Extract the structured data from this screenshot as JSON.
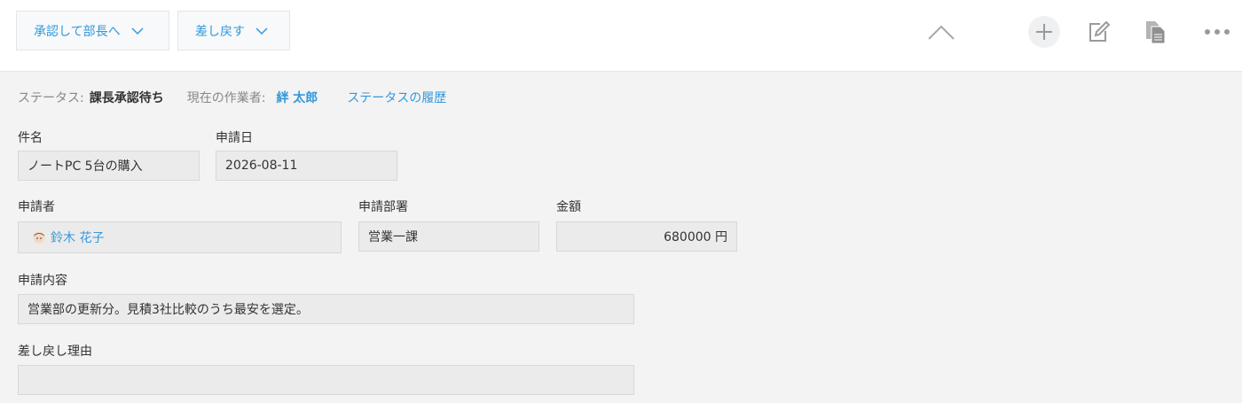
{
  "toolbar": {
    "approve_label": "承認して部長へ",
    "return_label": "差し戻す"
  },
  "icons": {
    "collapse": "chevron-up-icon",
    "add": "plus-icon",
    "edit": "edit-icon",
    "copy": "copy-icon",
    "more": "more-icon"
  },
  "status": {
    "label": "ステータス:",
    "value": "課長承認待ち",
    "assignee_label": "現在の作業者:",
    "assignee": "絆 太郎",
    "history_link": "ステータスの履歴"
  },
  "fields": {
    "subject": {
      "label": "件名",
      "value": "ノートPC 5台の購入"
    },
    "date": {
      "label": "申請日",
      "value": "2026-08-11"
    },
    "applicant": {
      "label": "申請者",
      "value": "鈴木 花子"
    },
    "department": {
      "label": "申請部署",
      "value": "営業一課"
    },
    "amount": {
      "label": "金額",
      "value": "680000 円"
    },
    "content": {
      "label": "申請内容",
      "value": "営業部の更新分。見積3社比較のうち最安を選定。"
    },
    "return_reason": {
      "label": "差し戻し理由",
      "value": ""
    }
  },
  "colors": {
    "accent": "#3498db",
    "background": "#f3f3f3",
    "field_bg": "#ebebeb"
  }
}
